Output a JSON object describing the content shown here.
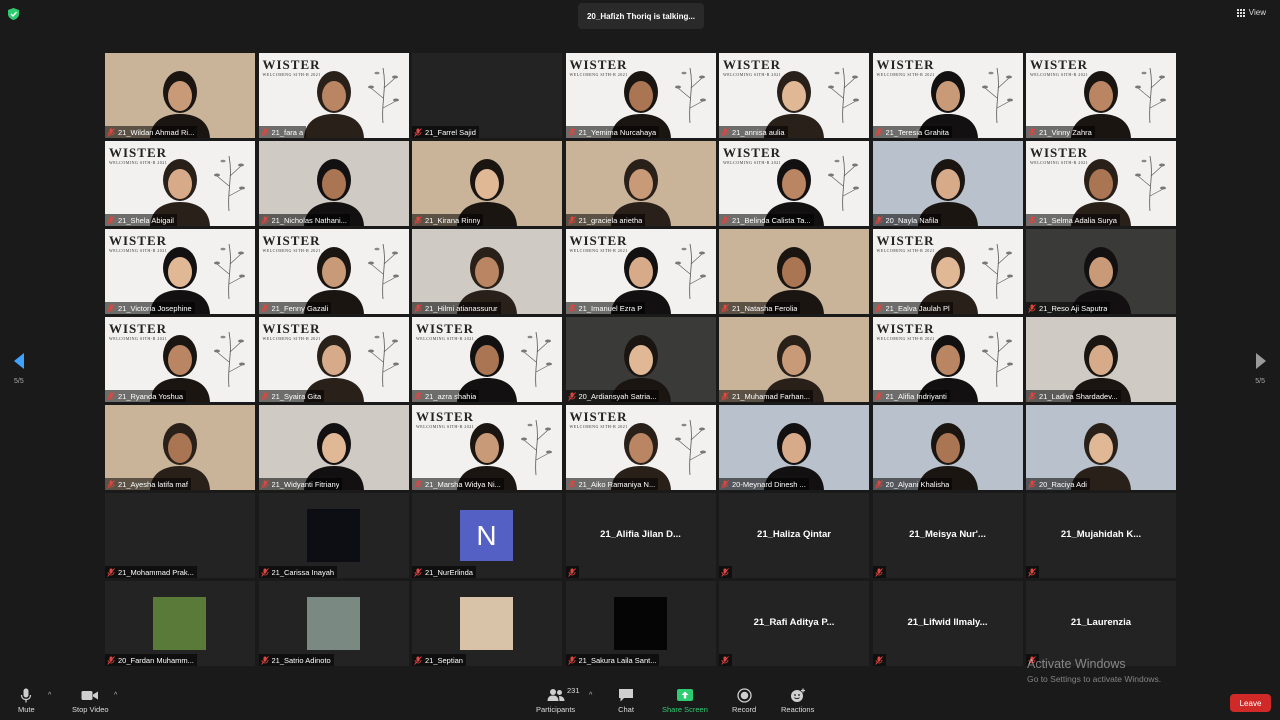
{
  "meeting": {
    "talking_indicator": "20_Hafizh Thoriq is talking...",
    "view_label": "View",
    "page_indicator": "5/5"
  },
  "participants": [
    {
      "name": "21_Wildan Ahmad Ri...",
      "kind": "video",
      "bg": "warm"
    },
    {
      "name": "21_fara a",
      "kind": "video",
      "bg": "poster"
    },
    {
      "name": "21_Farrel Sajid",
      "kind": "blank"
    },
    {
      "name": "21_Yemima Nurcahaya",
      "kind": "video",
      "bg": "poster"
    },
    {
      "name": "21_annisa aulia",
      "kind": "video",
      "bg": "poster"
    },
    {
      "name": "21_Teresia Grahita",
      "kind": "video",
      "bg": "poster"
    },
    {
      "name": "21_Vinny Zahra",
      "kind": "video",
      "bg": "poster"
    },
    {
      "name": "21_Shela Abigail",
      "kind": "video",
      "bg": "poster"
    },
    {
      "name": "21_Nicholas Nathani...",
      "kind": "video",
      "bg": "video"
    },
    {
      "name": "21_Kirana Rinny",
      "kind": "video",
      "bg": "warm"
    },
    {
      "name": "21_graciela arietha",
      "kind": "video",
      "bg": "warm"
    },
    {
      "name": "21_Belinda Calista Ta...",
      "kind": "video",
      "bg": "poster"
    },
    {
      "name": "20_Nayla Nafila",
      "kind": "video",
      "bg": "cool"
    },
    {
      "name": "21_Selma Adalia Surya",
      "kind": "video",
      "bg": "poster"
    },
    {
      "name": "21_Victoria Josephine",
      "kind": "video",
      "bg": "poster"
    },
    {
      "name": "21_Fenny Gazali",
      "kind": "video",
      "bg": "poster"
    },
    {
      "name": "21_Hilmi atianassurur",
      "kind": "video",
      "bg": "video"
    },
    {
      "name": "21_Imanuel Ezra P",
      "kind": "video",
      "bg": "poster"
    },
    {
      "name": "21_Natasha Ferolia",
      "kind": "video",
      "bg": "warm"
    },
    {
      "name": "21_Ealva Jaulah Pl",
      "kind": "video",
      "bg": "poster"
    },
    {
      "name": "21_Reso Aji Saputra",
      "kind": "video",
      "bg": "dark"
    },
    {
      "name": "21_Ryanda Yoshua",
      "kind": "video",
      "bg": "poster"
    },
    {
      "name": "21_Syaira Gita",
      "kind": "video",
      "bg": "poster"
    },
    {
      "name": "21_azra shahia",
      "kind": "video",
      "bg": "poster"
    },
    {
      "name": "20_Ardiansyah Satria...",
      "kind": "video",
      "bg": "dark"
    },
    {
      "name": "21_Muhamad Farhan...",
      "kind": "video",
      "bg": "warm"
    },
    {
      "name": "21_Alifia Indriyanti",
      "kind": "video",
      "bg": "poster"
    },
    {
      "name": "21_Ladiva Shardadev...",
      "kind": "video",
      "bg": "video"
    },
    {
      "name": "21_Ayesha latifa maf",
      "kind": "video",
      "bg": "warm"
    },
    {
      "name": "21_Widyanti Fitriany",
      "kind": "video",
      "bg": "video"
    },
    {
      "name": "21_Marsha Widya Ni...",
      "kind": "video",
      "bg": "poster"
    },
    {
      "name": "21_Aiko Ramaniya N...",
      "kind": "video",
      "bg": "poster"
    },
    {
      "name": "20-Meynard Dinesh ...",
      "kind": "video",
      "bg": "cool"
    },
    {
      "name": "20_Alyani Khalisha",
      "kind": "video",
      "bg": "cool"
    },
    {
      "name": "20_Raciya Adi",
      "kind": "video",
      "bg": "cool"
    },
    {
      "name": "21_Mohammad Prak...",
      "kind": "blank"
    },
    {
      "name": "21_Carissa Inayah",
      "kind": "thumb",
      "thumb_color": "#0d0d14"
    },
    {
      "name": "21_NurErlinda",
      "kind": "letter",
      "letter": "N"
    },
    {
      "name": "21_Alifia Jilan D...",
      "kind": "text"
    },
    {
      "name": "21_Haliza Qintar",
      "kind": "text"
    },
    {
      "name": "21_Meisya Nur'...",
      "kind": "text"
    },
    {
      "name": "21_Mujahidah K...",
      "kind": "text"
    },
    {
      "name": "20_Fardan Muhamm...",
      "kind": "thumb",
      "thumb_color": "#5a7a3a"
    },
    {
      "name": "21_Satrio Adinoto",
      "kind": "thumb",
      "thumb_color": "#7a8a82"
    },
    {
      "name": "21_Septian",
      "kind": "thumb",
      "thumb_color": "#d8c2a8"
    },
    {
      "name": "21_Sakura Laila Sant...",
      "kind": "thumb",
      "thumb_color": "#050505"
    },
    {
      "name": "21_Rafi Aditya P...",
      "kind": "text"
    },
    {
      "name": "21_Lifwid Ilmaly...",
      "kind": "text"
    },
    {
      "name": "21_Laurenzia",
      "kind": "text"
    }
  ],
  "poster": {
    "heading": "WISTER",
    "subheading": "WELCOMING SITH-R 2021"
  },
  "watermark": {
    "title": "Activate Windows",
    "subtitle": "Go to Settings to activate Windows."
  },
  "toolbar": {
    "mute": "Mute",
    "stop_video": "Stop Video",
    "participants": "Participants",
    "participant_count": "231",
    "chat": "Chat",
    "share_screen": "Share Screen",
    "record": "Record",
    "reactions": "Reactions",
    "leave": "Leave"
  },
  "colors": {
    "accent_green": "#2ecc71",
    "leave_red": "#cf2a27",
    "nav_blue": "#3ea3ff",
    "mute_red": "#e0463e"
  }
}
